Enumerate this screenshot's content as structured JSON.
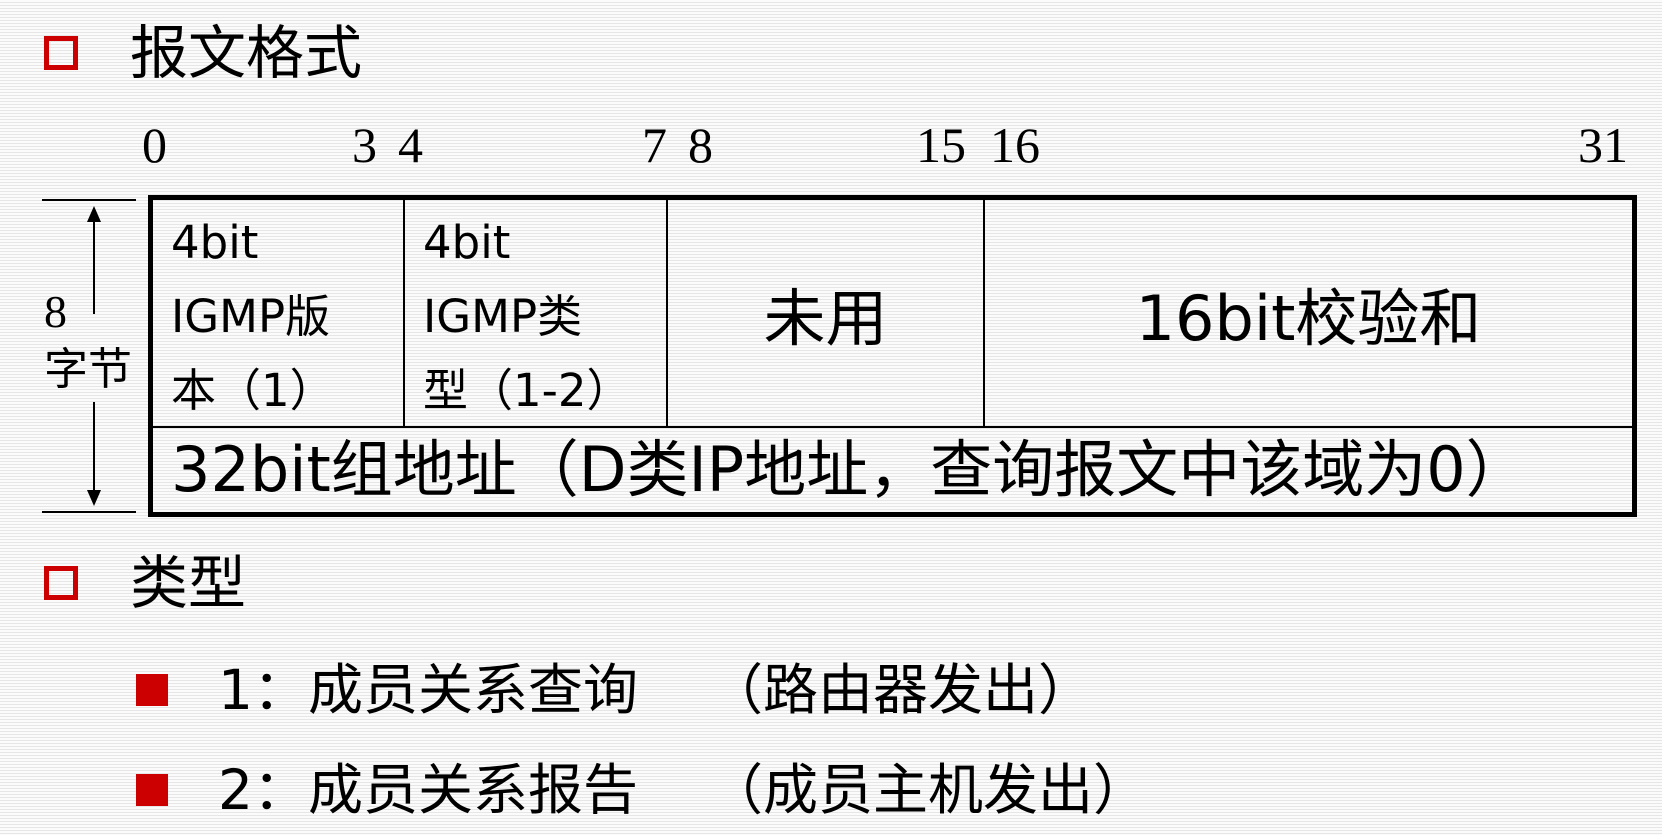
{
  "section1": {
    "title": "报文格式"
  },
  "bit_labels": [
    "0",
    "3",
    "4",
    "7",
    "8",
    "15",
    "16",
    "31"
  ],
  "packet": {
    "row1": [
      {
        "lines": [
          "4bit",
          "IGMP版",
          "本（1）"
        ]
      },
      {
        "lines": [
          "4bit",
          "IGMP类",
          "型（1-2）"
        ]
      },
      {
        "text": "未用"
      },
      {
        "text": "16bit校验和"
      }
    ],
    "row2": "32bit组地址（D类IP地址，查询报文中该域为0）"
  },
  "side_dimension": {
    "value": "8",
    "unit": "字节"
  },
  "section2": {
    "title": "类型",
    "items": [
      {
        "label": "1：成员关系查询",
        "note": "（路由器发出）"
      },
      {
        "label": "2：成员关系报告",
        "note": "（成员主机发出）"
      }
    ]
  },
  "colors": {
    "bullet": "#cc0000",
    "border": "#000000"
  }
}
